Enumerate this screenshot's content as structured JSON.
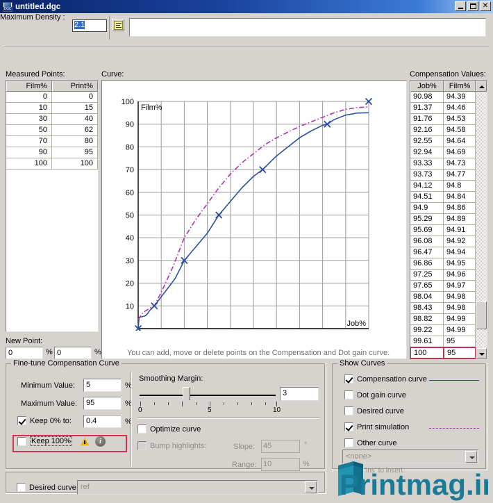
{
  "window": {
    "title": "untitled.dgc",
    "icon": "dgc-document-icon",
    "buttons": {
      "minimize": "_",
      "maximize": "□",
      "close": "✕"
    }
  },
  "top": {
    "max_density_label": "Maximum Density :",
    "max_density_value": "2.1",
    "note_icon": "note-icon",
    "comment_value": ""
  },
  "measured": {
    "section_label": "Measured Points:",
    "columns": [
      "Film%",
      "Print%"
    ],
    "rows": [
      [
        "0",
        "0"
      ],
      [
        "10",
        "15"
      ],
      [
        "30",
        "40"
      ],
      [
        "50",
        "62"
      ],
      [
        "70",
        "80"
      ],
      [
        "90",
        "95"
      ],
      [
        "100",
        "100"
      ]
    ]
  },
  "new_point": {
    "label": "New Point:",
    "x_value": "0",
    "x_unit": "%",
    "y_value": "0",
    "y_unit": "%"
  },
  "curve": {
    "section_label": "Curve:",
    "hint": "You can add, move or delete points on the Compensation and Dot gain curve."
  },
  "compensation": {
    "section_label": "Compensation Values:",
    "columns": [
      "Job%",
      "Film%"
    ],
    "rows": [
      [
        "90.98",
        "94.39"
      ],
      [
        "91.37",
        "94.46"
      ],
      [
        "91.76",
        "94.53"
      ],
      [
        "92.16",
        "94.58"
      ],
      [
        "92.55",
        "94.64"
      ],
      [
        "92.94",
        "94.69"
      ],
      [
        "93.33",
        "94.73"
      ],
      [
        "93.73",
        "94.77"
      ],
      [
        "94.12",
        "94.8"
      ],
      [
        "94.51",
        "94.84"
      ],
      [
        "94.9",
        "94.86"
      ],
      [
        "95.29",
        "94.89"
      ],
      [
        "95.69",
        "94.91"
      ],
      [
        "96.08",
        "94.92"
      ],
      [
        "96.47",
        "94.94"
      ],
      [
        "96.86",
        "94.95"
      ],
      [
        "97.25",
        "94.96"
      ],
      [
        "97.65",
        "94.97"
      ],
      [
        "98.04",
        "94.98"
      ],
      [
        "98.43",
        "94.98"
      ],
      [
        "98.82",
        "94.99"
      ],
      [
        "99.22",
        "94.99"
      ],
      [
        "99.61",
        "95"
      ],
      [
        "100",
        "95"
      ]
    ],
    "selected_row_index": 23
  },
  "finetune": {
    "title": "Fine-tune Compensation Curve",
    "minimum_label": "Minimum Value:",
    "minimum_value": "5",
    "minimum_unit": "%",
    "maximum_label": "Maximum Value:",
    "maximum_value": "95",
    "maximum_unit": "%",
    "keep0_label": "Keep 0% to:",
    "keep0_checked": true,
    "keep0_value": "0.4",
    "keep0_unit": "%",
    "keep100_label": "Keep 100%",
    "keep100_checked": false,
    "warn_icon": "warning-icon",
    "info_icon": "info-icon",
    "smoothing_label": "Smoothing Margin:",
    "smoothing_value": "3",
    "smoothing_ticks": [
      "0",
      "5",
      "10"
    ],
    "optimize_label": "Optimize curve",
    "optimize_checked": false,
    "bump_label": "Bump highlights:",
    "bump_checked": false,
    "slope_label": "Slope:",
    "slope_value": "45",
    "slope_unit": "°",
    "range_label": "Range:",
    "range_value": "10",
    "range_unit": "%",
    "desired_curve_label": "Desired curve:",
    "desired_curve_checked": false,
    "desired_curve_value": "ref"
  },
  "show_curves": {
    "title": "Show Curves",
    "items": [
      {
        "label": "Compensation curve",
        "checked": true,
        "line": "solid",
        "color": "#2b4fa0"
      },
      {
        "label": "Dot gain curve",
        "checked": false,
        "line": "none",
        "color": "#2b4fa0"
      },
      {
        "label": "Desired curve",
        "checked": false,
        "line": "none",
        "color": "#2b4fa0"
      },
      {
        "label": "Print simulation",
        "checked": true,
        "line": "dashdot",
        "color": "#b22fb2"
      },
      {
        "label": "Other curve",
        "checked": false,
        "line": "none",
        "color": "#2b4fa0"
      }
    ],
    "other_curve_value": "<none>",
    "press_label": "press 'ins' to insert"
  },
  "watermark": {
    "text": "Printmag.ir"
  },
  "colors": {
    "titlebar_start": "#0a246a",
    "titlebar_end": "#a6caf0",
    "face": "#d6d3ce",
    "compensation_line": "#2b4fa0",
    "print_sim_line": "#b22fb2",
    "highlight_red": "#d9304f",
    "selection_blue": "#316ac5"
  },
  "chart_data": {
    "type": "line",
    "title": "",
    "xlabel": "Job%",
    "ylabel": "Film%",
    "xlim": [
      0,
      100
    ],
    "ylim": [
      0,
      100
    ],
    "xticks": [
      10,
      20,
      30,
      40,
      50,
      60,
      70,
      80,
      90,
      100
    ],
    "yticks": [
      10,
      20,
      30,
      40,
      50,
      60,
      70,
      80,
      90,
      100
    ],
    "grid": true,
    "legend_position": "external-show-curves-panel",
    "series": [
      {
        "name": "Compensation curve",
        "style": "solid",
        "color": "#2b4fa0",
        "points": [
          [
            0,
            0
          ],
          [
            0.4,
            5
          ],
          [
            1.5,
            5.2
          ],
          [
            3,
            5.6
          ],
          [
            4,
            6.5
          ],
          [
            5,
            8
          ],
          [
            7,
            10
          ],
          [
            10,
            14
          ],
          [
            13,
            18
          ],
          [
            16,
            22
          ],
          [
            20,
            30
          ],
          [
            25,
            36
          ],
          [
            30,
            42
          ],
          [
            35,
            50
          ],
          [
            40,
            56
          ],
          [
            45,
            62
          ],
          [
            50,
            67
          ],
          [
            54,
            70
          ],
          [
            60,
            76
          ],
          [
            65,
            80
          ],
          [
            70,
            84
          ],
          [
            75,
            87
          ],
          [
            80,
            89.5
          ],
          [
            82,
            90
          ],
          [
            85,
            92
          ],
          [
            90,
            94
          ],
          [
            95,
            94.9
          ],
          [
            100,
            95
          ]
        ]
      },
      {
        "name": "Print simulation",
        "style": "dash-dot",
        "color": "#b22fb2",
        "points": [
          [
            0,
            4
          ],
          [
            2,
            7
          ],
          [
            5,
            9
          ],
          [
            7,
            10
          ],
          [
            10,
            16
          ],
          [
            15,
            27
          ],
          [
            20,
            40
          ],
          [
            25,
            48
          ],
          [
            30,
            55
          ],
          [
            35,
            62
          ],
          [
            40,
            68
          ],
          [
            45,
            73
          ],
          [
            50,
            77
          ],
          [
            55,
            81
          ],
          [
            60,
            84
          ],
          [
            65,
            86.5
          ],
          [
            70,
            89
          ],
          [
            75,
            91
          ],
          [
            80,
            93
          ],
          [
            85,
            95
          ],
          [
            90,
            96.5
          ],
          [
            95,
            97.3
          ],
          [
            100,
            97.6
          ]
        ]
      }
    ],
    "markers": {
      "name": "Measured points",
      "symbol": "x",
      "color": "#2b4fa0",
      "points": [
        [
          0,
          0
        ],
        [
          7,
          10
        ],
        [
          20,
          30
        ],
        [
          35,
          50
        ],
        [
          54,
          70
        ],
        [
          82,
          90
        ],
        [
          100,
          100
        ]
      ]
    }
  }
}
